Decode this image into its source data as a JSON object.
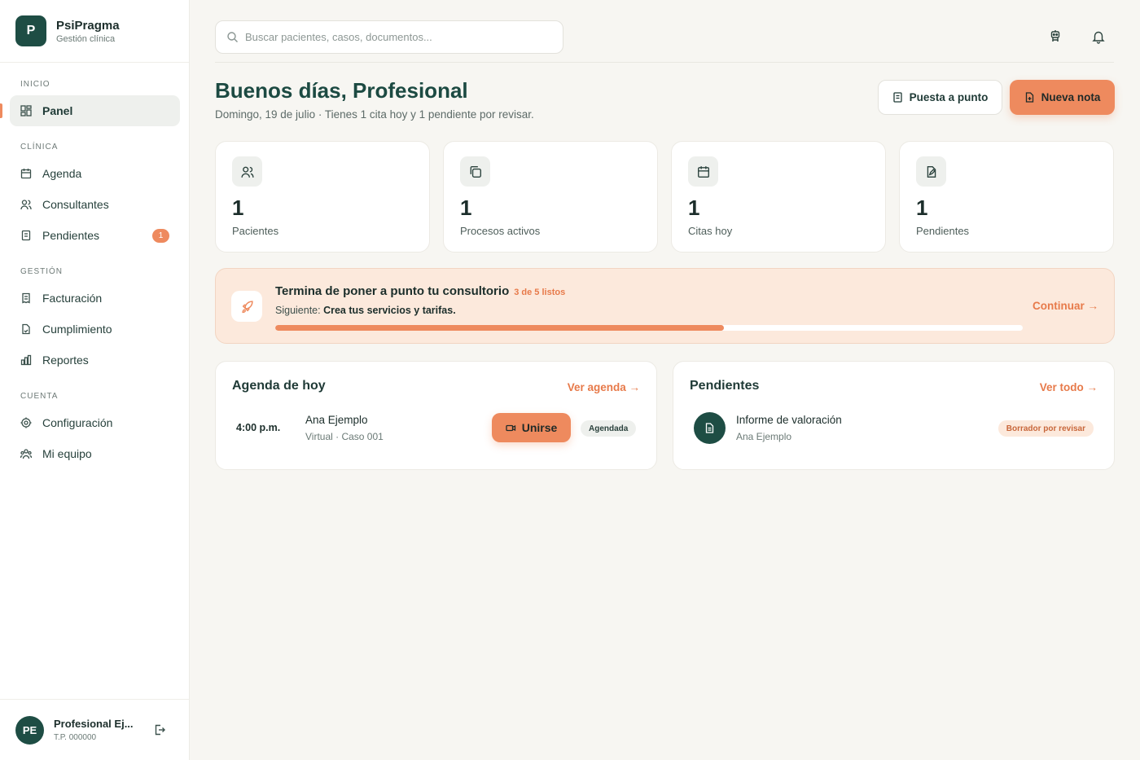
{
  "brand": {
    "logo_letter": "P",
    "name": "PsiPragma",
    "subtitle": "Gestión clínica"
  },
  "sidebar": {
    "sections": [
      {
        "title": "Inicio",
        "items": [
          {
            "label": "Panel",
            "icon": "dashboard-icon",
            "active": true
          }
        ]
      },
      {
        "title": "Clínica",
        "items": [
          {
            "label": "Agenda",
            "icon": "calendar-icon"
          },
          {
            "label": "Consultantes",
            "icon": "users-icon"
          },
          {
            "label": "Pendientes",
            "icon": "clipboard-icon",
            "badge": "1"
          }
        ]
      },
      {
        "title": "Gestión",
        "items": [
          {
            "label": "Facturación",
            "icon": "receipt-icon"
          },
          {
            "label": "Cumplimiento",
            "icon": "file-check-icon"
          },
          {
            "label": "Reportes",
            "icon": "bar-chart-icon"
          }
        ]
      },
      {
        "title": "Cuenta",
        "items": [
          {
            "label": "Configuración",
            "icon": "gear-icon"
          },
          {
            "label": "Mi equipo",
            "icon": "team-icon"
          }
        ]
      }
    ]
  },
  "user": {
    "initials": "PE",
    "name": "Profesional Ej...",
    "license": "T.P. 000000"
  },
  "search": {
    "placeholder": "Buscar pacientes, casos, documentos..."
  },
  "header": {
    "greeting": "Buenos días, Profesional",
    "subtitle": "Domingo, 19 de julio · Tienes 1 cita hoy y 1 pendiente por revisar.",
    "setup_button": "Puesta a punto",
    "new_note_button": "Nueva nota"
  },
  "stats": [
    {
      "value": "1",
      "label": "Pacientes",
      "icon": "users-icon"
    },
    {
      "value": "1",
      "label": "Procesos activos",
      "icon": "copy-icon"
    },
    {
      "value": "1",
      "label": "Citas hoy",
      "icon": "calendar-icon"
    },
    {
      "value": "1",
      "label": "Pendientes",
      "icon": "file-edit-icon"
    }
  ],
  "setup": {
    "title": "Termina de poner a punto tu consultorio",
    "count": "3 de 5 listos",
    "next_prefix": "Siguiente:",
    "next_step": "Crea tus servicios y tarifas.",
    "progress": 0.6,
    "link": "Continuar →"
  },
  "agenda": {
    "title": "Agenda de hoy",
    "link": "Ver agenda →",
    "appointment": {
      "time": "4:00 p.m.",
      "patient": "Ana Ejemplo",
      "detail": "Virtual · Caso 001",
      "join_button": "Unirse",
      "status": "Agendada"
    }
  },
  "pending": {
    "title": "Pendientes",
    "link": "Ver todo →",
    "item": {
      "title": "Informe de valoración",
      "patient": "Ana Ejemplo",
      "status": "Borrador por revisar"
    }
  },
  "colors": {
    "brand": "#1e4d44",
    "accent": "#ee8a5e",
    "background": "#f7f6f2"
  }
}
